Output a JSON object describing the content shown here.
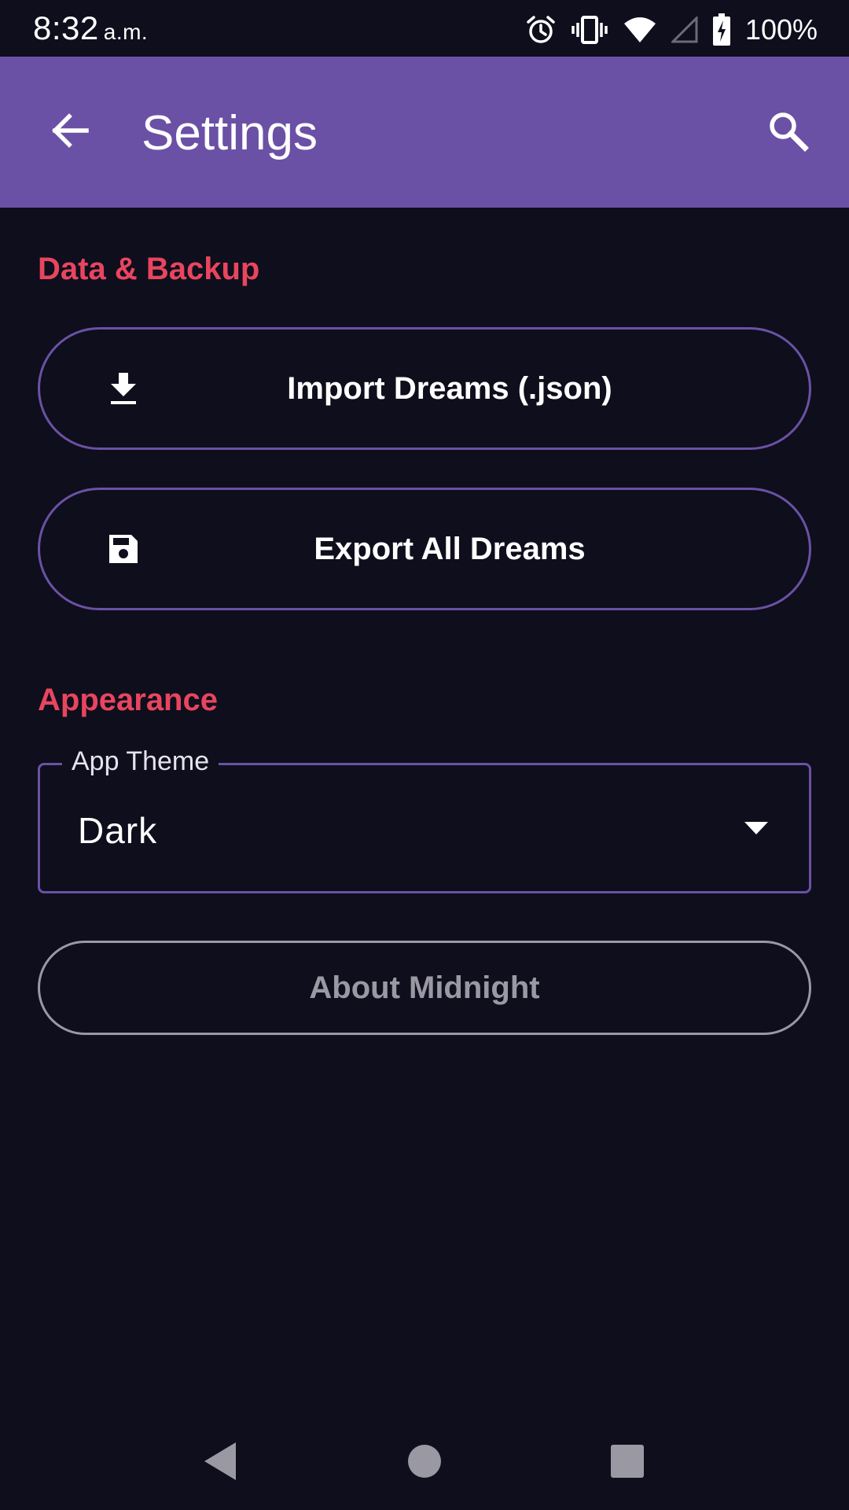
{
  "status_bar": {
    "time": "8:32",
    "time_suffix": "a.m.",
    "battery_percent": "100%",
    "icons": [
      "alarm-icon",
      "vibrate-icon",
      "wifi-icon",
      "signal-icon",
      "battery-charging-icon"
    ]
  },
  "app_bar": {
    "title": "Settings",
    "back_icon": "arrow-back-icon",
    "search_icon": "search-icon",
    "color": "#6a51a5"
  },
  "sections": {
    "data_backup": {
      "header": "Data & Backup",
      "import_button": {
        "label": "Import Dreams (.json)",
        "icon": "download-icon"
      },
      "export_button": {
        "label": "Export All Dreams",
        "icon": "save-icon"
      }
    },
    "appearance": {
      "header": "Appearance",
      "theme_field": {
        "label": "App Theme",
        "value": "Dark"
      }
    }
  },
  "about_button": {
    "label": "About Midnight"
  },
  "nav_bar": {
    "icons": [
      "nav-back-icon",
      "nav-home-icon",
      "nav-recents-icon"
    ]
  },
  "colors": {
    "background": "#0f0e1c",
    "accent": "#6a51a5",
    "section_header": "#e8455f",
    "muted": "#9a98a3"
  }
}
